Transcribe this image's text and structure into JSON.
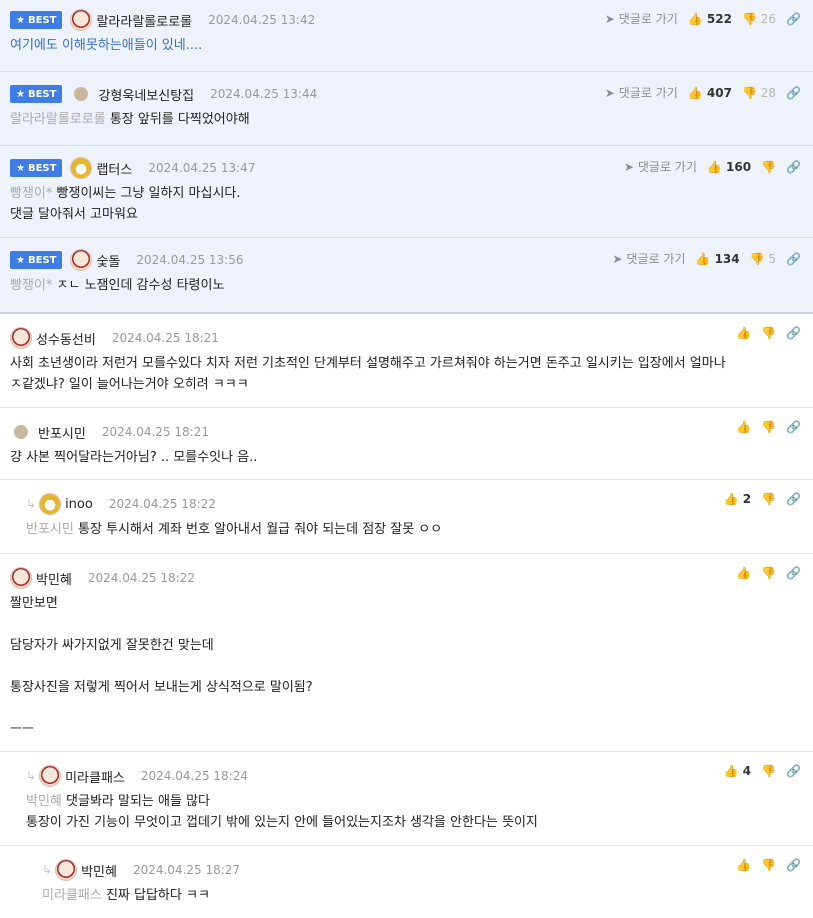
{
  "best_label": "BEST",
  "reply_go_label": "댓글로 가기",
  "best_comments": [
    {
      "author": "랄라라랄롤로로롤",
      "date": "2024.04.25 13:42",
      "up": "522",
      "down": "26",
      "ref": "",
      "text": "여기에도 이해못하는애들이 있네...."
    },
    {
      "author": "강형욱네보신탕집",
      "date": "2024.04.25 13:44",
      "up": "407",
      "down": "28",
      "ref": "랄라라랄롤로로롤",
      "text": "통장 앞뒤를 다찍었어야해"
    },
    {
      "author": "랩터스",
      "date": "2024.04.25 13:47",
      "up": "160",
      "down": "",
      "ref": "빵쟁이*",
      "text": "빵쟁이씨는 그냥 일하지 마십시다.",
      "text2": "댓글 달아줘서 고마워요"
    },
    {
      "author": "숯돌",
      "date": "2024.04.25 13:56",
      "up": "134",
      "down": "5",
      "ref": "빵쟁이*",
      "text": "ㅈㄴ 노잼인데 감수성 타령이노"
    }
  ],
  "comments": [
    {
      "author": "성수동선비",
      "date": "2024.04.25 18:21",
      "up": "",
      "text": "사회 초년생이라 저런거 모를수있다 치자 저런 기초적인 단계부터 설명해주고 가르쳐줘야 하는거면 돈주고 일시키는 입장에서 얼마나",
      "text2": "ㅈ같겠냐? 일이 늘어나는거야 오히려 ㅋㅋㅋ"
    },
    {
      "author": "반포시민",
      "date": "2024.04.25 18:21",
      "up": "",
      "text": "걍 사본 찍어달라는거아님? .. 모를수잇나 음.."
    },
    {
      "author": "inoo",
      "date": "2024.04.25 18:22",
      "up": "2",
      "ref": "반포시민",
      "text": "통장 투시해서 계좌 번호 알아내서 월급 줘야 되는데 점장 잘못 ㅇㅇ"
    },
    {
      "author": "박민혜",
      "date": "2024.04.25 18:22",
      "up": "",
      "lines": [
        "짤만보면",
        "",
        "담당자가 싸가지없게 잘못한건 맞는데",
        "",
        "통장사진을 저렇게 찍어서 보내는게 상식적으로 말이됨?",
        "",
        "ㅡㅡ"
      ]
    },
    {
      "author": "미라클패스",
      "date": "2024.04.25 18:24",
      "up": "4",
      "ref": "박민혜",
      "text": "댓글봐라 말되는 애들 많다",
      "text2": "통장이 가진 기능이 무엇이고 껍데기 밖에 있는지 안에 들어있는지조차 생각을 안한다는 뜻이지"
    },
    {
      "author": "박민혜",
      "date": "2024.04.25 18:27",
      "up": "",
      "ref": "미라클패스",
      "text": "진짜 답답하다 ㅋㅋ"
    }
  ]
}
